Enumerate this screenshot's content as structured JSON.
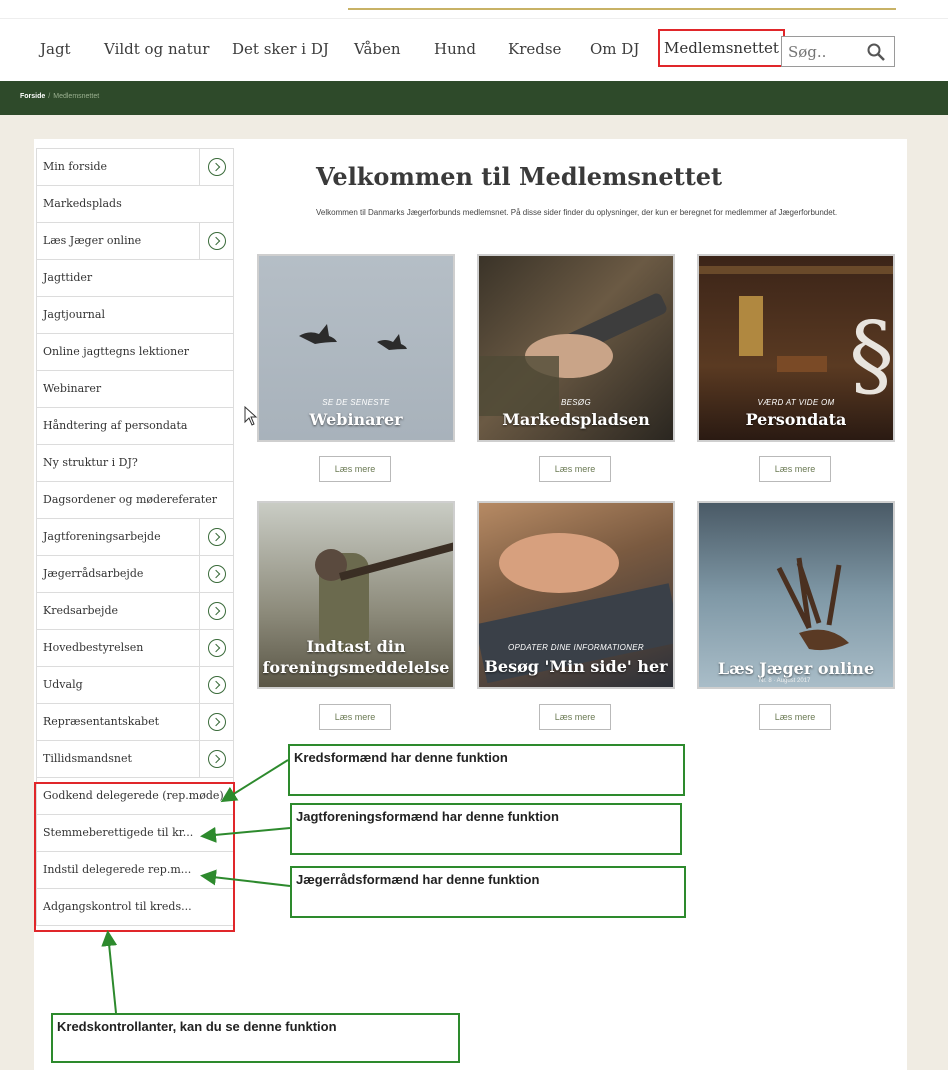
{
  "nav": {
    "items": [
      "Jagt",
      "Vildt og natur",
      "Det sker i DJ",
      "Våben",
      "Hund",
      "Kredse",
      "Om DJ"
    ],
    "active": "Medlemsnettet",
    "search_placeholder": "Søg.."
  },
  "breadcrumb": {
    "home": "Forside",
    "separator": "/",
    "current": "Medlemsnettet"
  },
  "sidebar": {
    "items": [
      {
        "label": "Min forside",
        "expandable": true
      },
      {
        "label": "Markedsplads",
        "expandable": false
      },
      {
        "label": "Læs Jæger online",
        "expandable": true
      },
      {
        "label": "Jagttider",
        "expandable": false
      },
      {
        "label": "Jagtjournal",
        "expandable": false
      },
      {
        "label": "Online jagttegns lektioner",
        "expandable": false
      },
      {
        "label": "Webinarer",
        "expandable": false
      },
      {
        "label": "Håndtering af persondata",
        "expandable": false
      },
      {
        "label": "Ny struktur i DJ?",
        "expandable": false
      },
      {
        "label": "Dagsordener og mødereferater",
        "expandable": false
      },
      {
        "label": "Jagtforeningsarbejde",
        "expandable": true
      },
      {
        "label": "Jægerrådsarbejde",
        "expandable": true
      },
      {
        "label": "Kredsarbejde",
        "expandable": true
      },
      {
        "label": "Hovedbestyrelsen",
        "expandable": true
      },
      {
        "label": "Udvalg",
        "expandable": true
      },
      {
        "label": "Repræsentantskabet",
        "expandable": true
      },
      {
        "label": "Tillidsmandsnet",
        "expandable": true
      },
      {
        "label": "Godkend delegerede (rep.møde)",
        "expandable": false
      },
      {
        "label": "Stemmeberettigede til kr...",
        "expandable": false
      },
      {
        "label": "Indstil delegerede rep.m...",
        "expandable": false
      },
      {
        "label": "Adgangskontrol til kreds...",
        "expandable": false
      }
    ]
  },
  "main": {
    "title": "Velkommen til Medlemsnettet",
    "intro": "Velkommen til Danmarks Jægerforbunds medlemsnet. På disse sider finder du oplysninger, der kun er beregnet for medlemmer af Jægerforbundet.",
    "read_more": "Læs mere",
    "tiles": [
      {
        "small": "SE DE SENESTE",
        "big": "Webinarer"
      },
      {
        "small": "BESØG",
        "big": "Markedspladsen"
      },
      {
        "small": "VÆRD AT VIDE OM",
        "big": "Persondata"
      },
      {
        "small": "",
        "big": "Indtast din",
        "big2": "foreningsmeddelelse"
      },
      {
        "small": "OPDATER DINE INFORMATIONER",
        "big": "Besøg 'Min side' her"
      },
      {
        "small": "",
        "big": "Læs Jæger online",
        "caption": "Nr. 8 · August 2017"
      }
    ]
  },
  "annotations": [
    "Kredsformænd har denne funktion",
    "Jagtforeningsformænd har denne funktion",
    "Jægerrådsformænd har denne funktion",
    "Kredskontrollanter, kan du se denne funktion"
  ],
  "colors": {
    "nav_dark_green": "#2e4a2a",
    "highlight_red": "#e0262a",
    "annotation_green": "#2d8a2d"
  }
}
